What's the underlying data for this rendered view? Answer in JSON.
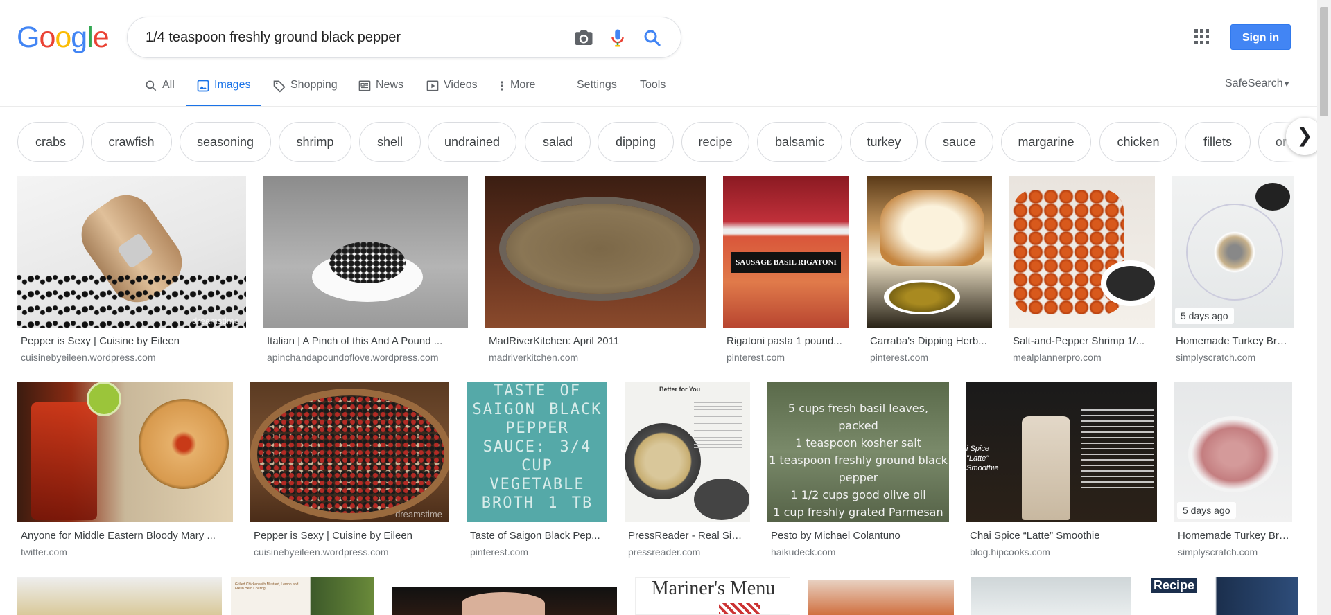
{
  "search": {
    "query": "1/4 teaspoon freshly ground black pepper"
  },
  "logo": {
    "letters": [
      "G",
      "o",
      "o",
      "g",
      "l",
      "e"
    ],
    "colors": [
      "#4285f4",
      "#ea4335",
      "#fbbc05",
      "#4285f4",
      "#34a853",
      "#ea4335"
    ]
  },
  "header": {
    "signin_label": "Sign in",
    "accent": "#4285f4"
  },
  "tabs": {
    "all": "All",
    "images": "Images",
    "shopping": "Shopping",
    "news": "News",
    "videos": "Videos",
    "more": "More",
    "settings": "Settings",
    "tools": "Tools"
  },
  "safesearch": "SafeSearch",
  "chips": [
    "crabs",
    "crawfish",
    "seasoning",
    "shrimp",
    "shell",
    "undrained",
    "salad",
    "dipping",
    "recipe",
    "balsamic",
    "turkey",
    "sauce",
    "margarine",
    "chicken",
    "fillets",
    "or"
  ],
  "results": {
    "row1": [
      {
        "title": "Pepper is Sexy | Cuisine by Eileen",
        "site": "cuisinebyeileen.wordpress.com",
        "watermark": "dreamstime"
      },
      {
        "title": "Italian | A Pinch of this And A Pound ...",
        "site": "apinchandapoundoflove.wordpress.com"
      },
      {
        "title": "MadRiverKitchen: April 2011",
        "site": "madriverkitchen.com"
      },
      {
        "title": "Rigatoni pasta 1 pound...",
        "site": "pinterest.com",
        "overlay": "SAUSAGE BASIL RIGATONI"
      },
      {
        "title": "Carraba's Dipping Herb...",
        "site": "pinterest.com"
      },
      {
        "title": "Salt-and-Pepper Shrimp 1/...",
        "site": "mealplannerpro.com"
      },
      {
        "title": "Homemade Turkey Bre...",
        "site": "simplyscratch.com",
        "badge": "5 days ago"
      }
    ],
    "row2": [
      {
        "title": "Anyone for Middle Eastern Bloody Mary ...",
        "site": "twitter.com"
      },
      {
        "title": "Pepper is Sexy | Cuisine by Eileen",
        "site": "cuisinebyeileen.wordpress.com",
        "watermark": "dreamstime"
      },
      {
        "title": "Taste of Saigon Black Pep...",
        "site": "pinterest.com",
        "overlay": "TASTE OF SAIGON BLACK PEPPER SAUCE: 3/4 CUP VEGETABLE BROTH 1 TB"
      },
      {
        "title": "PressReader - Real Sim...",
        "site": "pressreader.com",
        "overlay": "Better for You"
      },
      {
        "title": "Pesto by Michael Colantuno",
        "site": "haikudeck.com",
        "overlay_lines": [
          "5 cups fresh basil leaves, packed",
          "1 teaspoon kosher salt",
          "1 teaspoon freshly ground black",
          "pepper",
          "1 1/2 cups good olive oil",
          "1 cup freshly grated Parmesan"
        ]
      },
      {
        "title": "Chai Spice “Latte” Smoothie",
        "site": "blog.hipcooks.com",
        "overlay": "i Spice \"Latte\" Smoothie"
      },
      {
        "title": "Homemade Turkey Bre...",
        "site": "simplyscratch.com",
        "badge": "5 days ago"
      }
    ],
    "row3": [
      {
        "overlay": ""
      },
      {
        "overlay": "Grilled Chicken with Mustard, Lemon and Fresh Herb Coating"
      },
      {
        "overlay": ""
      },
      {
        "overlay": "Mariner's Menu"
      },
      {
        "overlay": ""
      },
      {
        "overlay": ""
      },
      {
        "overlay": "Recipe"
      }
    ]
  }
}
